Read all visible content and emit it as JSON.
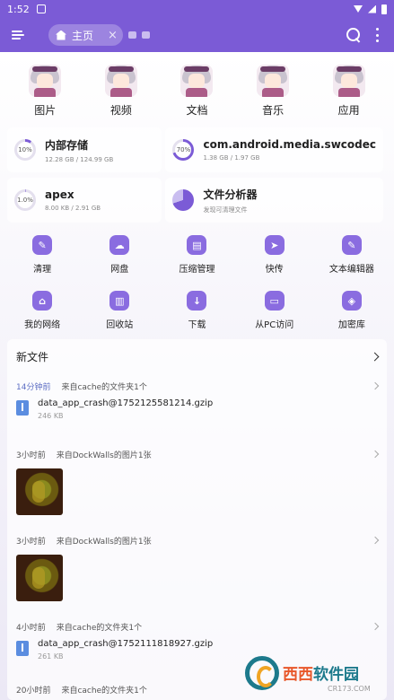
{
  "status_bar": {
    "time": "1:52"
  },
  "app_bar": {
    "tab_label": "主页",
    "tab_close": "×"
  },
  "categories": [
    {
      "label": "图片"
    },
    {
      "label": "视频"
    },
    {
      "label": "文档"
    },
    {
      "label": "音乐"
    },
    {
      "label": "应用"
    }
  ],
  "storage": [
    {
      "name": "内部存储",
      "detail": "12.28 GB / 124.99 GB",
      "percent": "10%"
    },
    {
      "name": "com.android.media.swcodec",
      "detail": "1.38 GB / 1.97 GB",
      "percent": "70%"
    },
    {
      "name": "apex",
      "detail": "8.00 KB / 2.91 GB",
      "percent": "1.0%"
    },
    {
      "name": "文件分析器",
      "detail": "发现可清理文件"
    }
  ],
  "tools": [
    {
      "label": "清理",
      "glyph": "✎"
    },
    {
      "label": "网盘",
      "glyph": "☁"
    },
    {
      "label": "压缩管理",
      "glyph": "▤"
    },
    {
      "label": "快传",
      "glyph": "➤"
    },
    {
      "label": "文本编辑器",
      "glyph": "✎"
    },
    {
      "label": "我的网络",
      "glyph": "⌂"
    },
    {
      "label": "回收站",
      "glyph": "▥"
    },
    {
      "label": "下载",
      "glyph": "↓"
    },
    {
      "label": "从PC访问",
      "glyph": "▭"
    },
    {
      "label": "加密库",
      "glyph": "◈"
    }
  ],
  "recent": {
    "title": "新文件",
    "groups": [
      {
        "when": "14分钟前",
        "source": "来自cache的文件夹1个",
        "file_name": "data_app_crash@1752125581214.gzip",
        "file_size": "246 KB"
      },
      {
        "when": "3小时前",
        "source": "来自DockWalls的图片1张"
      },
      {
        "when": "3小时前",
        "source": "来自DockWalls的图片1张"
      },
      {
        "when": "4小时前",
        "source": "来自cache的文件夹1个",
        "file_name": "data_app_crash@1752111818927.gzip",
        "file_size": "261 KB"
      },
      {
        "when": "20小时前",
        "source": "来自cache的文件夹1个"
      }
    ]
  },
  "watermark": {
    "text_a": "西西",
    "text_b": "软件园",
    "url": "CR173.COM"
  },
  "colors": {
    "accent": "#7b5bd6",
    "tool_icon": "#8a6ce0",
    "file_icon": "#5b8de0"
  }
}
